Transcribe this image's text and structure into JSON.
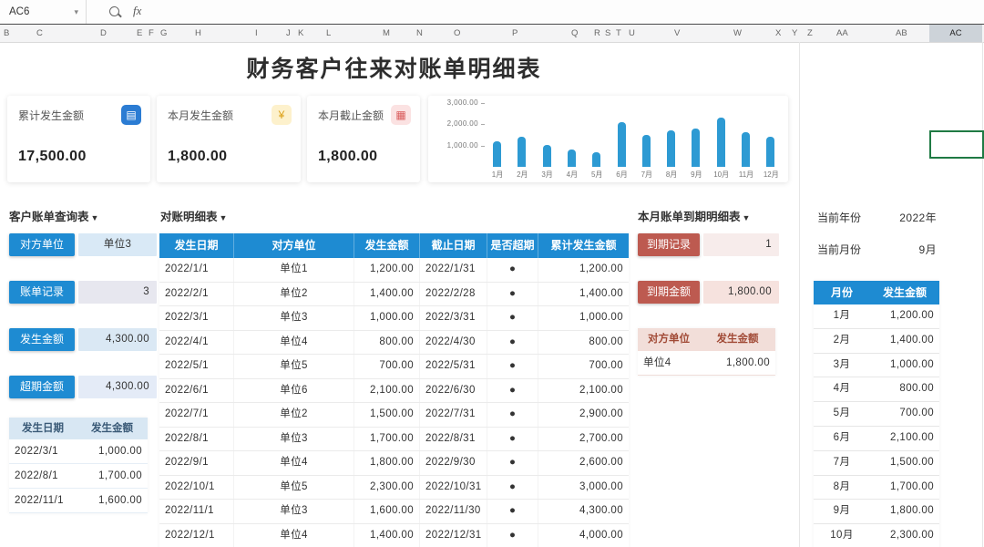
{
  "chrome": {
    "name_box": "AC6",
    "fx_label": "fx",
    "column_letters": [
      "B",
      "C",
      "D",
      "E",
      "F",
      "G",
      "H",
      "I",
      "J",
      "K",
      "L",
      "M",
      "N",
      "O",
      "P",
      "Q",
      "R",
      "S",
      "T",
      "U",
      "V",
      "W",
      "X",
      "Y",
      "Z",
      "AA",
      "AB",
      "AC"
    ],
    "selected_column": "AC"
  },
  "title": "财务客户往来对账单明细表",
  "kpis": [
    {
      "label": "累计发生金额",
      "value": "17,500.00",
      "icon": "wallet-icon"
    },
    {
      "label": "本月发生金额",
      "value": "1,800.00",
      "icon": "coins-icon"
    },
    {
      "label": "本月截止金额",
      "value": "1,800.00",
      "icon": "calculator-icon"
    }
  ],
  "chart_data": {
    "type": "bar",
    "title": "",
    "xlabel": "",
    "ylabel": "",
    "categories": [
      "1月",
      "2月",
      "3月",
      "4月",
      "5月",
      "6月",
      "7月",
      "8月",
      "9月",
      "10月",
      "11月",
      "12月"
    ],
    "values": [
      1200,
      1400,
      1000,
      800,
      700,
      2100,
      1500,
      1700,
      1800,
      2300,
      1600,
      1400
    ],
    "ylim": [
      0,
      3000
    ],
    "yticks": [
      3000,
      2000,
      1000
    ],
    "ytick_labels": [
      "3,000.00",
      "2,000.00",
      "1,000.00"
    ],
    "bar_color": "#2d9ad3",
    "grid": false,
    "legend": false
  },
  "query_panel": {
    "title": "客户账单查询表",
    "dropdown": "▼",
    "fields": [
      {
        "label": "对方单位",
        "value": "单位3"
      },
      {
        "label": "账单记录",
        "value": "3"
      },
      {
        "label": "发生金额",
        "value": "4,300.00"
      },
      {
        "label": "超期金额",
        "value": "4,300.00"
      }
    ],
    "table": {
      "headers": [
        "发生日期",
        "发生金额"
      ],
      "rows": [
        [
          "2022/3/1",
          "1,000.00"
        ],
        [
          "2022/8/1",
          "1,700.00"
        ],
        [
          "2022/11/1",
          "1,600.00"
        ]
      ]
    }
  },
  "detail_panel": {
    "title": "对账明细表",
    "dropdown": "▼",
    "table": {
      "headers": [
        "发生日期",
        "对方单位",
        "发生金额",
        "截止日期",
        "是否超期",
        "累计发生金额"
      ],
      "rows": [
        [
          "2022/1/1",
          "单位1",
          "1,200.00",
          "2022/1/31",
          "●",
          "1,200.00"
        ],
        [
          "2022/2/1",
          "单位2",
          "1,400.00",
          "2022/2/28",
          "●",
          "1,400.00"
        ],
        [
          "2022/3/1",
          "单位3",
          "1,000.00",
          "2022/3/31",
          "●",
          "1,000.00"
        ],
        [
          "2022/4/1",
          "单位4",
          "800.00",
          "2022/4/30",
          "●",
          "800.00"
        ],
        [
          "2022/5/1",
          "单位5",
          "700.00",
          "2022/5/31",
          "●",
          "700.00"
        ],
        [
          "2022/6/1",
          "单位6",
          "2,100.00",
          "2022/6/30",
          "●",
          "2,100.00"
        ],
        [
          "2022/7/1",
          "单位2",
          "1,500.00",
          "2022/7/31",
          "●",
          "2,900.00"
        ],
        [
          "2022/8/1",
          "单位3",
          "1,700.00",
          "2022/8/31",
          "●",
          "2,700.00"
        ],
        [
          "2022/9/1",
          "单位4",
          "1,800.00",
          "2022/9/30",
          "●",
          "2,600.00"
        ],
        [
          "2022/10/1",
          "单位5",
          "2,300.00",
          "2022/10/31",
          "●",
          "3,000.00"
        ],
        [
          "2022/11/1",
          "单位3",
          "1,600.00",
          "2022/11/30",
          "●",
          "4,300.00"
        ],
        [
          "2022/12/1",
          "单位4",
          "1,400.00",
          "2022/12/31",
          "●",
          "4,000.00"
        ]
      ]
    }
  },
  "due_panel": {
    "title": "本月账单到期明细表",
    "dropdown": "▼",
    "fields": [
      {
        "label": "到期记录",
        "value": "1"
      },
      {
        "label": "到期金额",
        "value": "1,800.00"
      }
    ],
    "table": {
      "headers": [
        "对方单位",
        "发生金额"
      ],
      "rows": [
        [
          "单位4",
          "1,800.00"
        ]
      ]
    }
  },
  "right_panel": {
    "year_label": "当前年份",
    "year_value": "2022年",
    "month_label": "当前月份",
    "month_value": "9月",
    "table": {
      "headers": [
        "月份",
        "发生金额"
      ],
      "rows": [
        [
          "1月",
          "1,200.00"
        ],
        [
          "2月",
          "1,400.00"
        ],
        [
          "3月",
          "1,000.00"
        ],
        [
          "4月",
          "800.00"
        ],
        [
          "5月",
          "700.00"
        ],
        [
          "6月",
          "2,100.00"
        ],
        [
          "7月",
          "1,500.00"
        ],
        [
          "8月",
          "1,700.00"
        ],
        [
          "9月",
          "1,800.00"
        ],
        [
          "10月",
          "2,300.00"
        ]
      ]
    }
  },
  "colors": {
    "header_blue": "#1e8bd2",
    "button_red": "#bd5a50",
    "overdue_dot": "#b0563c",
    "selection_green": "#1f7a44"
  }
}
